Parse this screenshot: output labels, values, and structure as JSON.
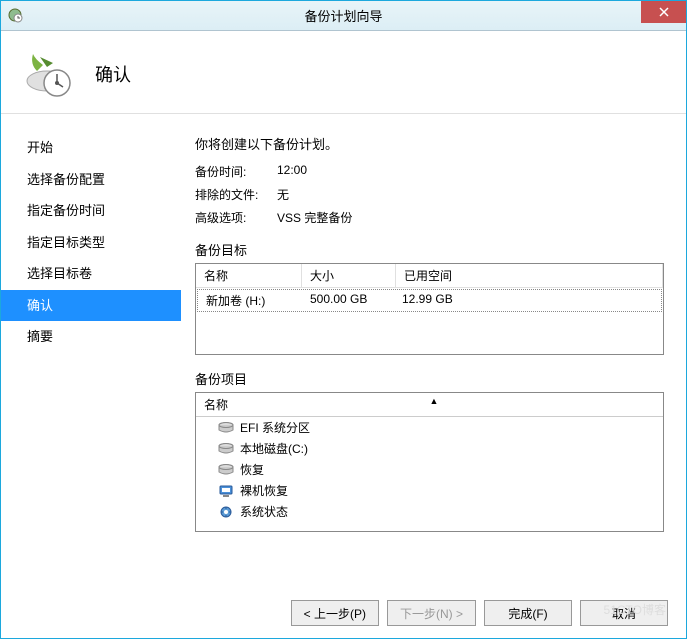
{
  "window": {
    "title": "备份计划向导"
  },
  "page": {
    "title": "确认"
  },
  "nav": {
    "items": [
      {
        "label": "开始"
      },
      {
        "label": "选择备份配置"
      },
      {
        "label": "指定备份时间"
      },
      {
        "label": "指定目标类型"
      },
      {
        "label": "选择目标卷"
      },
      {
        "label": "确认"
      },
      {
        "label": "摘要"
      }
    ],
    "selected_index": 5
  },
  "content": {
    "intro": "你将创建以下备份计划。",
    "backup_time_label": "备份时间:",
    "backup_time_value": "12:00",
    "exclude_label": "排除的文件:",
    "exclude_value": "无",
    "advanced_label": "高级选项:",
    "advanced_value": "VSS 完整备份",
    "target_section": "备份目标",
    "target_table": {
      "headers": {
        "name": "名称",
        "size": "大小",
        "used": "已用空间"
      },
      "rows": [
        {
          "name": "新加卷 (H:)",
          "size": "500.00 GB",
          "used": "12.99 GB"
        }
      ]
    },
    "items_section": "备份项目",
    "items_header": "名称",
    "items": [
      {
        "label": "EFI 系统分区",
        "icon": "disk"
      },
      {
        "label": "本地磁盘(C:)",
        "icon": "disk"
      },
      {
        "label": "恢复",
        "icon": "disk"
      },
      {
        "label": "裸机恢复",
        "icon": "computer"
      },
      {
        "label": "系统状态",
        "icon": "gear"
      }
    ]
  },
  "buttons": {
    "prev": "< 上一步(P)",
    "next": "下一步(N) >",
    "finish": "完成(F)",
    "cancel": "取消"
  },
  "watermark": "51CTO博客"
}
